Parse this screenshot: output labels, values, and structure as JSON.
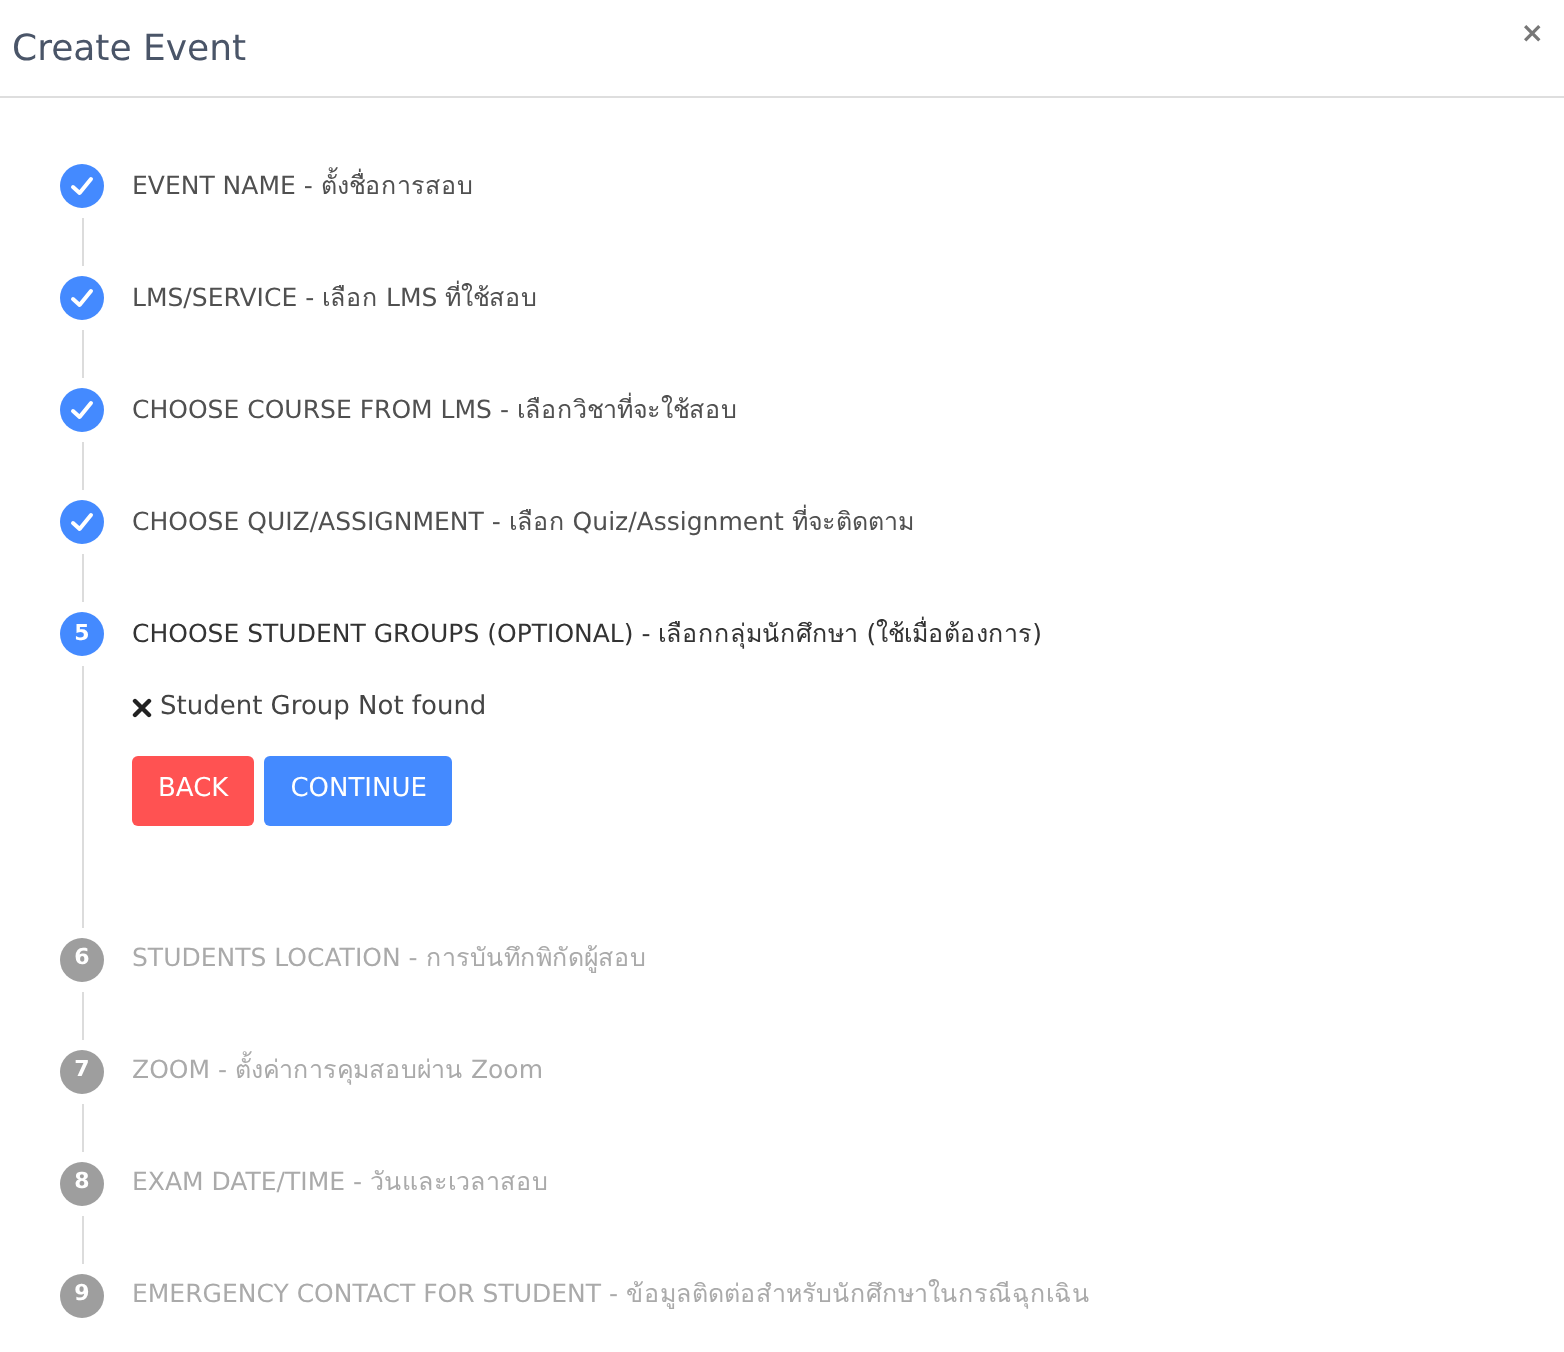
{
  "dialog": {
    "title": "Create Event",
    "close": "×"
  },
  "steps": [
    {
      "completed": true,
      "selected": false,
      "label": "EVENT NAME - ตั้งชื่อการสอบ"
    },
    {
      "completed": true,
      "selected": false,
      "label": "LMS/SERVICE - เลือก LMS ที่ใช้สอบ"
    },
    {
      "completed": true,
      "selected": false,
      "label": "CHOOSE COURSE FROM LMS - เลือกวิชาที่จะใช้สอบ"
    },
    {
      "completed": true,
      "selected": false,
      "label": "CHOOSE QUIZ/ASSIGNMENT - เลือก Quiz/Assignment ที่จะติดตาม"
    },
    {
      "completed": false,
      "selected": true,
      "number": "5",
      "label": "CHOOSE STUDENT GROUPS (OPTIONAL) - เลือกกลุ่มนักศึกษา (ใช้เมื่อต้องการ)",
      "message": "Student Group Not found",
      "buttons": [
        {
          "kind": "back",
          "label": "BACK"
        },
        {
          "kind": "continue",
          "label": "CONTINUE"
        }
      ]
    },
    {
      "completed": false,
      "selected": false,
      "number": "6",
      "label": "STUDENTS LOCATION - การบันทึกพิกัดผู้สอบ"
    },
    {
      "completed": false,
      "selected": false,
      "number": "7",
      "label": "ZOOM - ตั้งค่าการคุมสอบผ่าน Zoom"
    },
    {
      "completed": false,
      "selected": false,
      "number": "8",
      "label": "EXAM DATE/TIME - วันและเวลาสอบ"
    },
    {
      "completed": false,
      "selected": false,
      "number": "9",
      "label": "EMERGENCY CONTACT FOR STUDENT - ข้อมูลติดต่อสำหรับนักศึกษาในกรณีฉุกเฉิน"
    }
  ]
}
